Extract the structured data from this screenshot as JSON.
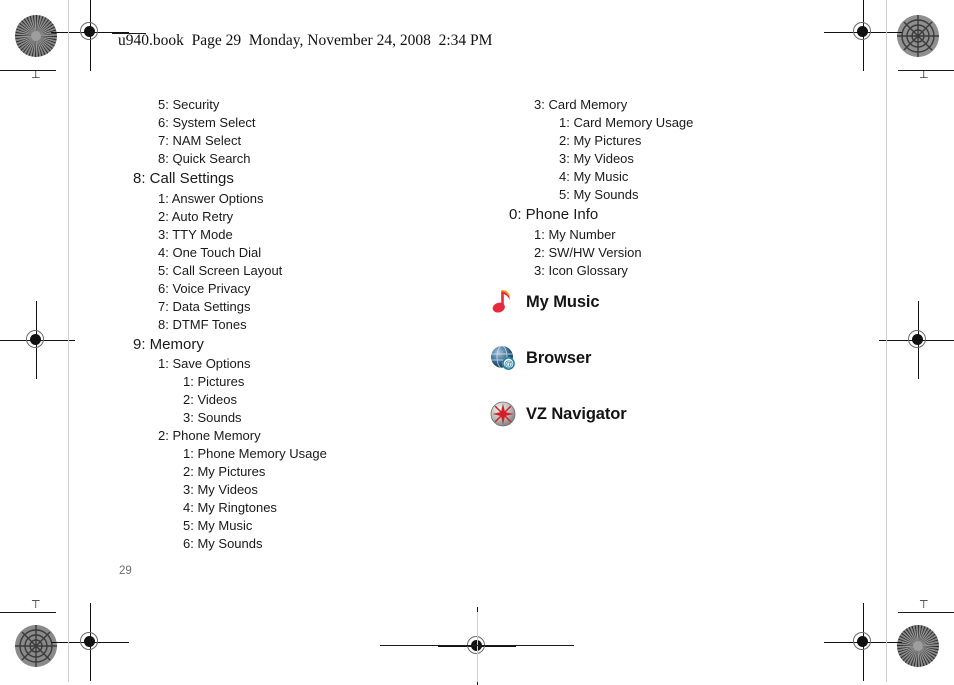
{
  "header": {
    "text": "u940.book  Page 29  Monday, November 24, 2008  2:34 PM"
  },
  "page_number": "29",
  "left_column": {
    "items": [
      {
        "level": 2,
        "label": "5: Security"
      },
      {
        "level": 2,
        "label": "6: System Select"
      },
      {
        "level": 2,
        "label": "7: NAM Select"
      },
      {
        "level": 2,
        "label": "8: Quick Search"
      },
      {
        "level": 1,
        "label": "8: Call Settings"
      },
      {
        "level": 2,
        "label": "1: Answer Options"
      },
      {
        "level": 2,
        "label": "2: Auto Retry"
      },
      {
        "level": 2,
        "label": "3: TTY Mode"
      },
      {
        "level": 2,
        "label": "4: One Touch Dial"
      },
      {
        "level": 2,
        "label": "5: Call Screen Layout"
      },
      {
        "level": 2,
        "label": "6: Voice Privacy"
      },
      {
        "level": 2,
        "label": "7: Data Settings"
      },
      {
        "level": 2,
        "label": "8: DTMF Tones"
      },
      {
        "level": 1,
        "label": "9: Memory"
      },
      {
        "level": 2,
        "label": "1: Save Options"
      },
      {
        "level": 3,
        "label": "1: Pictures"
      },
      {
        "level": 3,
        "label": "2: Videos"
      },
      {
        "level": 3,
        "label": "3: Sounds"
      },
      {
        "level": 2,
        "label": "2: Phone Memory"
      },
      {
        "level": 3,
        "label": "1: Phone Memory Usage"
      },
      {
        "level": 3,
        "label": "2: My Pictures"
      },
      {
        "level": 3,
        "label": "3: My Videos"
      },
      {
        "level": 3,
        "label": "4: My Ringtones"
      },
      {
        "level": 3,
        "label": "5: My Music"
      },
      {
        "level": 3,
        "label": "6: My Sounds"
      }
    ]
  },
  "right_column": {
    "items": [
      {
        "level": 2,
        "label": "3: Card Memory"
      },
      {
        "level": 3,
        "label": "1: Card Memory Usage"
      },
      {
        "level": 3,
        "label": "2: My Pictures"
      },
      {
        "level": 3,
        "label": "3: My Videos"
      },
      {
        "level": 3,
        "label": "4: My Music"
      },
      {
        "level": 3,
        "label": "5: My Sounds"
      },
      {
        "level": 1,
        "label": "0: Phone Info"
      },
      {
        "level": 2,
        "label": "1: My Number"
      },
      {
        "level": 2,
        "label": "2: SW/HW Version"
      },
      {
        "level": 2,
        "label": "3: Icon Glossary"
      }
    ]
  },
  "features": [
    {
      "icon": "music-note-icon",
      "label": "My Music"
    },
    {
      "icon": "globe-browser-icon",
      "label": "Browser"
    },
    {
      "icon": "compass-navigator-icon",
      "label": "VZ Navigator"
    }
  ],
  "colors": {
    "music_note_red": "#E8283C",
    "music_note_highlight": "#F5A623",
    "globe_blue": "#2C5E86",
    "globe_light": "#A8C6DC",
    "at_badge_teal": "#1C7F9E",
    "navigator_grey": "#B8B8B8",
    "navigator_red": "#D02026",
    "page_number_grey": "#6E6E6E",
    "text_black": "#1A1A1A"
  }
}
